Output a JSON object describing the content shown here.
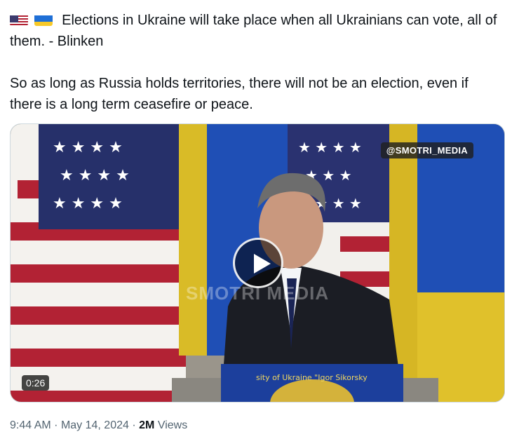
{
  "tweet": {
    "emoji_flags": [
      "us-flag-icon",
      "ukraine-flag-icon"
    ],
    "line1": "Elections in Ukraine will take place when all Ukrainians can vote, all of them. - Blinken",
    "line2": "So as long as Russia holds territories, there will not be an election, even if there is a long term ceasefire or peace."
  },
  "media": {
    "watermark": "@SMOTRI_MEDIA",
    "center_watermark": "SMOTRI MEDIA",
    "podium_text": "sity of Ukraine \"Igor Sikorsky",
    "duration": "0:26",
    "play_icon": "play-icon"
  },
  "meta": {
    "time": "9:44 AM",
    "separator": "·",
    "date": "May 14, 2024",
    "views_count": "2M",
    "views_label": "Views"
  },
  "colors": {
    "text": "#0f1419",
    "secondary": "#536471",
    "ukraine_blue": "#1f4fb5",
    "ukraine_yellow": "#e0c12b",
    "us_red": "#b22234",
    "us_blue": "#3c3b6e"
  }
}
